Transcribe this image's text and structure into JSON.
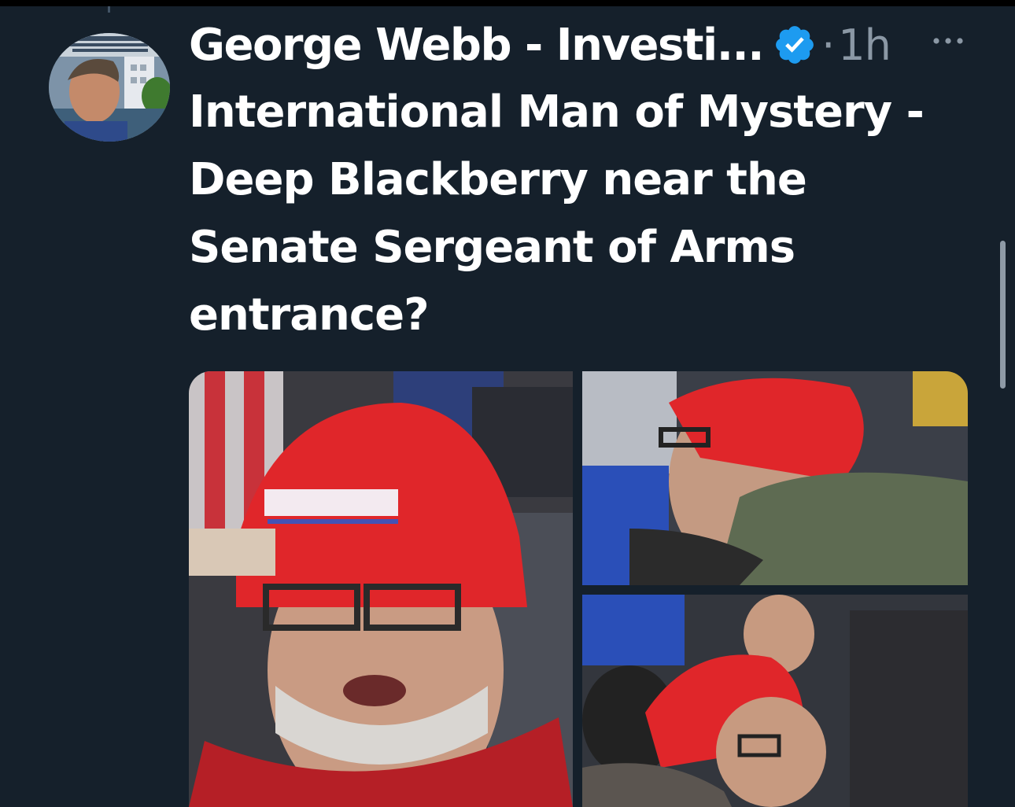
{
  "tweet": {
    "author_name": "George Webb - Investi...",
    "separator": "·",
    "timestamp": "1h",
    "text": "International Man of Mystery -\nDeep Blackberry near the\nSenate Sergeant of Arms\nentrance?"
  },
  "icons": {
    "verified": "verified-badge-icon",
    "more": "more-options-icon"
  },
  "colors": {
    "background": "#15202b",
    "verified": "#1d9bf0",
    "muted_text": "#8b98a5",
    "hat_red": "#e0262a"
  },
  "media": {
    "photo_count": 3
  }
}
